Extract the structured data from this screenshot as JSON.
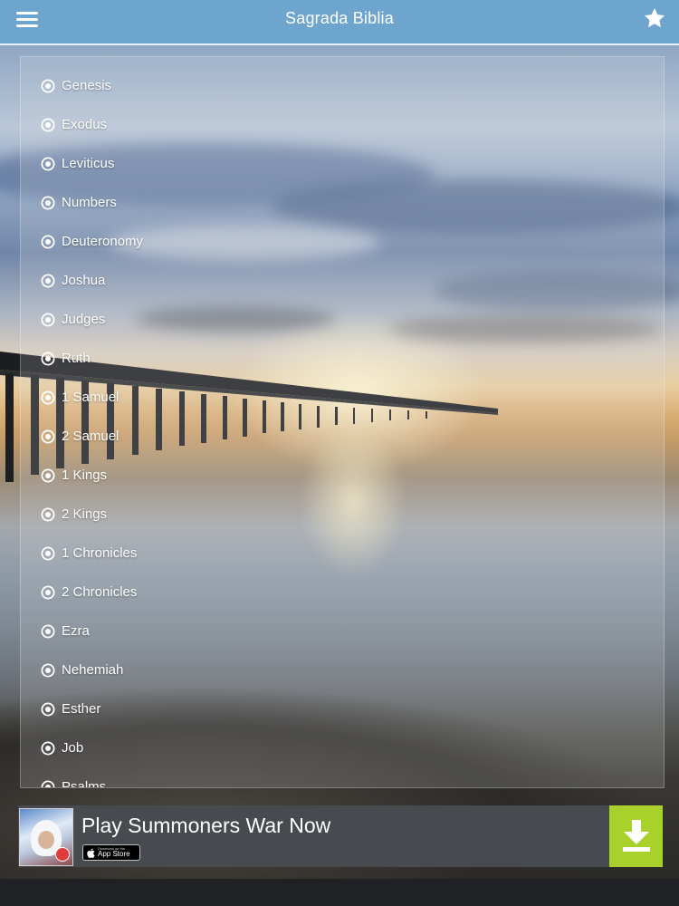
{
  "header": {
    "title": "Sagrada Biblia",
    "menu_icon": "hamburger-menu-icon",
    "favorite_icon": "star-icon"
  },
  "books": [
    "Genesis",
    "Exodus",
    "Leviticus",
    "Numbers",
    "Deuteronomy",
    "Joshua",
    "Judges",
    "Ruth",
    "1 Samuel",
    "2 Samuel",
    "1 Kings",
    "2 Kings",
    "1 Chronicles",
    "2 Chronicles",
    "Ezra",
    "Nehemiah",
    "Esther",
    "Job",
    "Psalms"
  ],
  "book_icon": "eye-icon",
  "ad": {
    "title": "Play Summoners War Now",
    "store_badge_small": "Download on the",
    "store_badge_label": "App Store",
    "download_icon": "download-icon"
  },
  "colors": {
    "header": "#6ea5cf",
    "ad_background": "#474a4e",
    "download_button": "#a9d12b"
  }
}
